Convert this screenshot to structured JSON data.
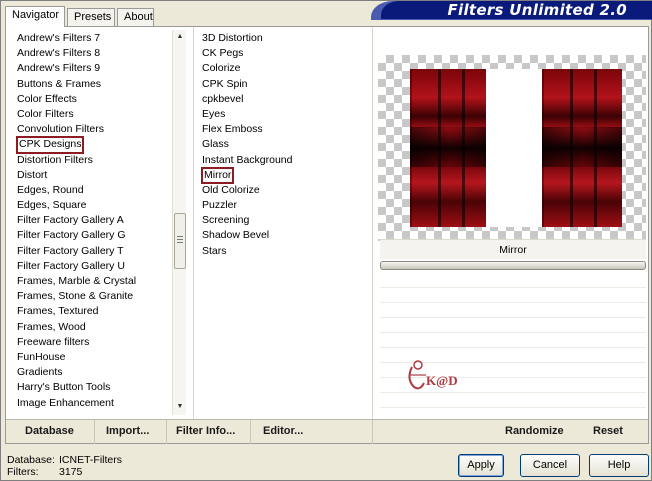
{
  "title": "Filters Unlimited 2.0",
  "tabs": [
    {
      "label": "Navigator"
    },
    {
      "label": "Presets"
    },
    {
      "label": "About"
    }
  ],
  "categories": [
    "Andrew's Filters 7",
    "Andrew's Filters 8",
    "Andrew's Filters 9",
    "Buttons & Frames",
    "Color Effects",
    "Color Filters",
    "Convolution Filters",
    "CPK Designs",
    "Distortion Filters",
    "Distort",
    "Edges, Round",
    "Edges, Square",
    "Filter Factory Gallery A",
    "Filter Factory Gallery G",
    "Filter Factory Gallery T",
    "Filter Factory Gallery U",
    "Frames, Marble & Crystal",
    "Frames, Stone & Granite",
    "Frames, Textured",
    "Frames, Wood",
    "Freeware filters",
    "FunHouse",
    "Gradients",
    "Harry's Button Tools",
    "Image Enhancement"
  ],
  "selected_category": "CPK Designs",
  "filters": [
    "3D Distortion",
    "CK Pegs",
    "Colorize",
    "CPK Spin",
    "cpkbevel",
    "Eyes",
    "Flex Emboss",
    "Glass",
    "Instant Background",
    "Mirror",
    "Old Colorize",
    "Puzzler",
    "Screening",
    "Shadow Bevel",
    "Stars"
  ],
  "selected_filter": "Mirror",
  "preview_param_label": "Mirror",
  "logo_text": "K@D",
  "toolbar": {
    "database": "Database",
    "import": "Import...",
    "filter_info": "Filter Info...",
    "editor": "Editor...",
    "randomize": "Randomize",
    "reset": "Reset"
  },
  "info": {
    "database_label": "Database:",
    "database_value": "ICNET-Filters",
    "filters_label": "Filters:",
    "filters_value": "3175"
  },
  "buttons": {
    "apply": "Apply",
    "cancel": "Cancel",
    "help": "Help"
  },
  "colors": {
    "banner": "#0a1a7a",
    "selection_outline": "#8b1c24",
    "dark_red": "#7a0509"
  }
}
